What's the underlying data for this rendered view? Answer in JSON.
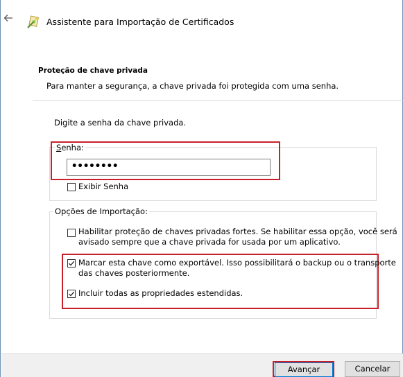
{
  "window": {
    "title": "Assistente para Importação de Certificados"
  },
  "header": {
    "back_icon": "back-arrow-icon",
    "wizard_icon": "certificate-wizard-icon"
  },
  "section": {
    "title": "Proteção de chave privada",
    "description": "Para manter a segurança, a chave privada foi protegida com uma senha."
  },
  "form": {
    "prompt": "Digite a senha da chave privada.",
    "password": {
      "label": "Senha:",
      "value": "••••••••"
    },
    "show_password": {
      "label": "Exibir Senha",
      "checked": false
    },
    "import_options": {
      "legend": "Opções de Importação:",
      "strong_protection": {
        "label_line1": "Habilitar proteção de chaves privadas fortes. Se habilitar essa opção, você será",
        "label_line2": "avisado sempre que a chave privada for usada por um aplicativo.",
        "checked": false
      },
      "exportable": {
        "label_line1": "Marcar esta chave como exportável. Isso possibilitará o backup ou o transporte",
        "label_line2": "das chaves posteriormente.",
        "checked": true
      },
      "include_extended": {
        "label": "Incluir todas as propriedades estendidas.",
        "checked": true
      }
    }
  },
  "footer": {
    "next_label": "Avançar",
    "cancel_label": "Cancelar"
  },
  "colors": {
    "highlight": "#c8202a",
    "frame_border": "#6d8fb3",
    "footer_bg": "#f0f0f0"
  }
}
